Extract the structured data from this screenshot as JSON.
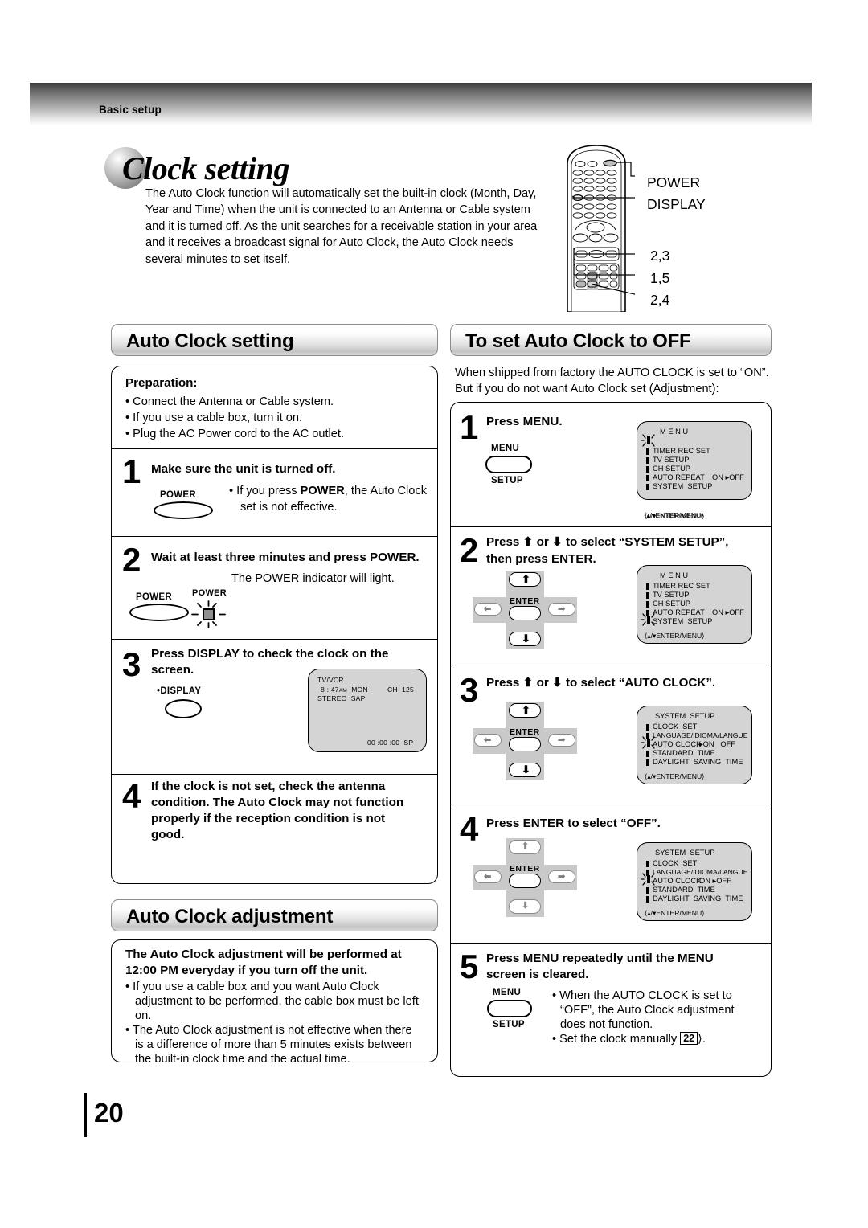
{
  "running_header": {
    "label": "Basic setup"
  },
  "title": {
    "text": "Clock setting"
  },
  "intro": {
    "paragraph": "The Auto Clock function will automatically set the built-in clock (Month, Day, Year and Time) when the unit  is connected to an Antenna or Cable system and it is turned off. As the unit searches for a receivable station in your area and it receives a broadcast signal for Auto Clock, the Auto Clock needs several minutes to set itself."
  },
  "remote_callouts": [
    {
      "label": "POWER"
    },
    {
      "label": "DISPLAY"
    },
    {
      "label": "2,3"
    },
    {
      "label": "1,5"
    },
    {
      "label": "2,4"
    }
  ],
  "left_column": {
    "section_title": "Auto Clock setting",
    "preparation": {
      "heading": "Preparation:",
      "items": [
        "Connect the Antenna or Cable system.",
        "If you use a cable box, turn it on.",
        "Plug the AC Power cord to the AC outlet."
      ]
    },
    "steps": [
      {
        "number": "1",
        "heading": "Make sure the unit is turned off.",
        "button_label": "POWER",
        "note_pre": "• If you press ",
        "note_bold": "POWER",
        "note_post": ", the Auto Clock",
        "note_line2": "set is not effective."
      },
      {
        "number": "2",
        "heading": "Wait at least three minutes and press POWER.",
        "note": "The POWER indicator will light.",
        "button_label": "POWER",
        "indicator_label": "POWER"
      },
      {
        "number": "3",
        "heading_line1": "Press DISPLAY to check the clock on the",
        "heading_line2": "screen.",
        "button_label": "DISPLAY",
        "button_bullet": "•",
        "tv_screen": {
          "line1": "TV/VCR",
          "time": "8 : 47",
          "ampm": "AM",
          "day": "MON",
          "channel": "CH  125",
          "audio": "STEREO  SAP",
          "counter": "00 :00 :00  SP"
        }
      },
      {
        "number": "4",
        "heading_lines": [
          "If the clock is not set, check the antenna",
          "condition. The Auto Clock may not function",
          "properly if the reception condition is not",
          "good."
        ]
      }
    ],
    "adjustment": {
      "section_title": "Auto Clock adjustment",
      "heading_line1": "The Auto Clock adjustment will be performed at",
      "heading_line2": "12:00 PM everyday if you turn off the unit.",
      "bullets": [
        [
          "If you use a cable box and you want Auto Clock",
          "adjustment to be performed, the cable box must be left",
          "on."
        ],
        [
          "The Auto Clock adjustment is not effective when there",
          "is a difference of more than 5 minutes exists between",
          "the built-in clock time and the actual time."
        ]
      ]
    }
  },
  "right_column": {
    "section_title": "To set Auto Clock to OFF",
    "intro_line1": "When shipped from factory the AUTO CLOCK is set to “ON”.",
    "intro_line2": "But if you do not want Auto Clock set (Adjustment):",
    "steps": [
      {
        "number": "1",
        "heading": "Press MENU.",
        "button_top": "MENU",
        "button_bottom": "SETUP",
        "osd": {
          "title": "M E N U",
          "rows": [
            {
              "label": "TIMER REC SET",
              "value": "",
              "cursor": true
            },
            {
              "label": "TV SETUP",
              "value": "",
              "cursor": false
            },
            {
              "label": "CH SETUP",
              "value": "",
              "cursor": false
            },
            {
              "label": "AUTO REPEAT",
              "value": "ON ▸OFF",
              "cursor": false
            },
            {
              "label": "SYSTEM  SETUP",
              "value": "",
              "cursor": false
            }
          ],
          "footer": "⟨▴/▾ENTER/MENU⟩"
        }
      },
      {
        "number": "2",
        "heading_line1_pre": "Press ",
        "heading_line1_post": " to select “SYSTEM SETUP”,",
        "heading_line2": "then press ENTER.",
        "pad_enter": "ENTER",
        "osd": {
          "title": "M E N U",
          "rows": [
            {
              "label": "TIMER REC SET",
              "value": "",
              "cursor": false
            },
            {
              "label": "TV SETUP",
              "value": "",
              "cursor": false
            },
            {
              "label": "CH SETUP",
              "value": "",
              "cursor": false
            },
            {
              "label": "AUTO REPEAT",
              "value": "ON ▸OFF",
              "cursor": false
            },
            {
              "label": "SYSTEM  SETUP",
              "value": "",
              "cursor": true
            }
          ],
          "footer": "⟨▴/▾ENTER/MENU⟩"
        }
      },
      {
        "number": "3",
        "heading_pre": "Press ",
        "heading_post": " to select “AUTO CLOCK”.",
        "pad_enter": "ENTER",
        "osd": {
          "title": "SYSTEM  SETUP",
          "rows": [
            {
              "label": "CLOCK  SET",
              "value": "",
              "cursor": false
            },
            {
              "label": "LANGUAGE/IDIOMA/LANGUE",
              "value": "",
              "cursor": false
            },
            {
              "label": "AUTO CLOCK",
              "value": "▸ON   OFF",
              "cursor": true
            },
            {
              "label": "STANDARD  TIME",
              "value": "",
              "cursor": false
            },
            {
              "label": "DAYLIGHT  SAVING  TIME",
              "value": "",
              "cursor": false
            }
          ],
          "footer": "⟨▴/▾ENTER/MENU⟩"
        }
      },
      {
        "number": "4",
        "heading": "Press ENTER to select “OFF”.",
        "pad_enter": "ENTER",
        "osd": {
          "title": "SYSTEM  SETUP",
          "rows": [
            {
              "label": "CLOCK  SET",
              "value": "",
              "cursor": false
            },
            {
              "label": "LANGUAGE/IDIOMA/LANGUE",
              "value": "",
              "cursor": false
            },
            {
              "label": "AUTO CLOCK",
              "value": "ON ▸OFF",
              "cursor": true
            },
            {
              "label": "STANDARD  TIME",
              "value": "",
              "cursor": false
            },
            {
              "label": "DAYLIGHT  SAVING  TIME",
              "value": "",
              "cursor": false
            }
          ],
          "footer": "⟨▴/▾ENTER/MENU⟩"
        }
      },
      {
        "number": "5",
        "heading_line1": "Press MENU repeatedly until the MENU",
        "heading_line2": "screen is cleared.",
        "button_top": "MENU",
        "button_bottom": "SETUP",
        "notes": [
          [
            "• When  the  AUTO  CLOCK  is  set  to",
            "“OFF”,  the  Auto  Clock  adjustment",
            "does not function."
          ],
          [
            "• Set the clock manually ",
            "22",
            "."
          ]
        ]
      }
    ]
  },
  "page_number": "20"
}
